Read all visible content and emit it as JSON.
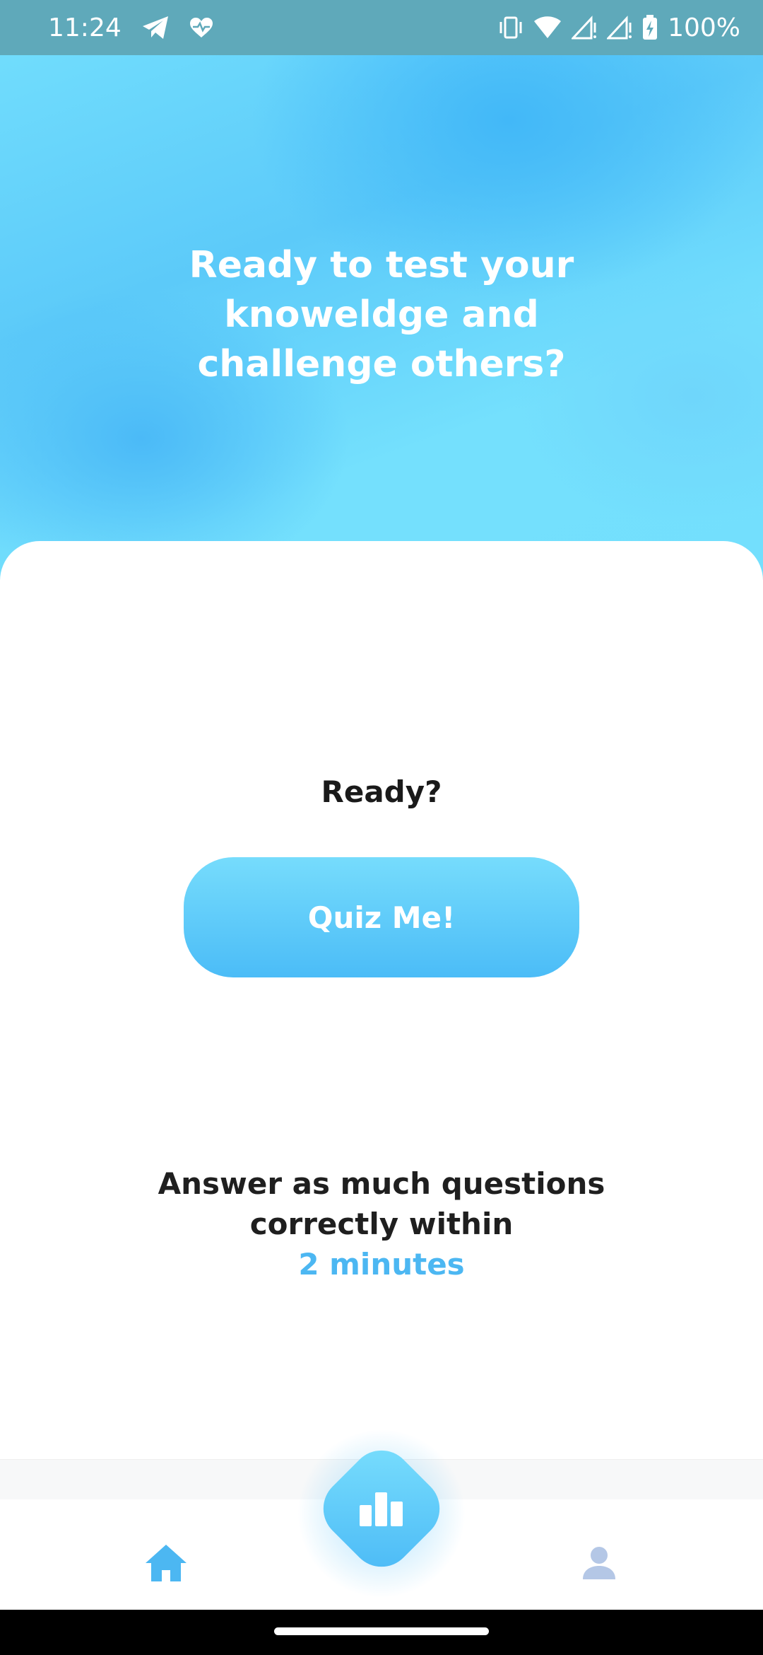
{
  "status_bar": {
    "time": "11:24",
    "battery": "100%",
    "icons": [
      "telegram-icon",
      "health-icon",
      "vibrate-icon",
      "wifi-icon",
      "signal-icon",
      "signal-icon",
      "battery-icon"
    ]
  },
  "hero": {
    "title": "Ready to test your knoweldge and challenge others?"
  },
  "main": {
    "ready_label": "Ready?",
    "quiz_button_label": "Quiz Me!",
    "info_line1": "Answer as much questions",
    "info_line2": "correctly within",
    "info_highlight": "2 minutes"
  },
  "bottom_nav": {
    "items": [
      {
        "icon": "home-icon",
        "active": true
      },
      {
        "icon": "leaderboard-icon",
        "active": false
      },
      {
        "icon": "profile-icon",
        "active": false
      }
    ]
  },
  "colors": {
    "accent": "#4cb7f2",
    "hero_light": "#74e0fd",
    "hero_dark": "#42b8f8",
    "inactive_icon": "#b4c7e6"
  }
}
